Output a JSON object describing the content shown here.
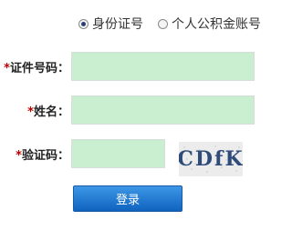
{
  "search_type": {
    "options": [
      {
        "label": "身份证号",
        "checked": true
      },
      {
        "label": "个人公积金账号",
        "checked": false
      }
    ]
  },
  "form": {
    "id_label": "证件号码：",
    "name_label": "姓名：",
    "captcha_label": "验证码：",
    "required_mark": "*",
    "id_value": "",
    "name_value": "",
    "captcha_value": ""
  },
  "captcha_text": "CDfK",
  "login_label": "登录"
}
